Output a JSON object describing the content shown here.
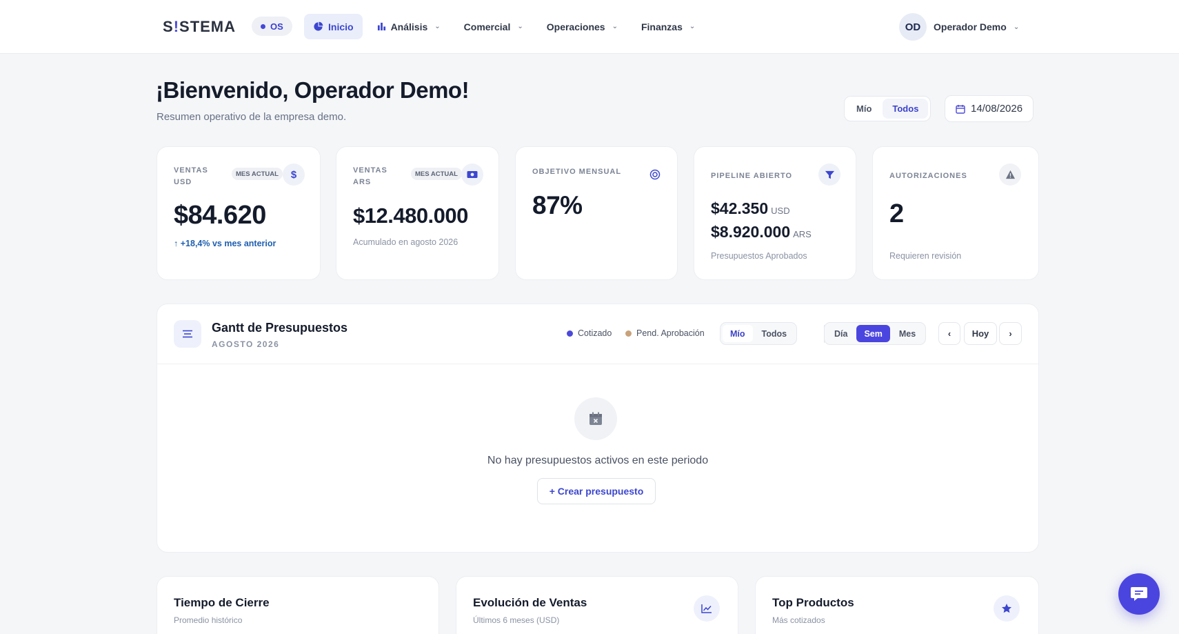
{
  "brand": {
    "logo_prefix": "S",
    "logo_bang": "!",
    "logo_suffix": "STEMA"
  },
  "os_badge": "OS",
  "nav": [
    {
      "label": "Inicio",
      "icon": "pie-chart-icon"
    },
    {
      "label": "Análisis",
      "icon": "bar-chart-icon"
    },
    {
      "label": "Comercial"
    },
    {
      "label": "Operaciones"
    },
    {
      "label": "Finanzas"
    }
  ],
  "user": {
    "initials": "OD",
    "name": "Operador Demo"
  },
  "header": {
    "title": "¡Bienvenido, Operador Demo!",
    "subtitle": "Resumen operativo de la empresa demo.",
    "scope": [
      "Mío",
      "Todos"
    ],
    "scope_selected": "Todos",
    "date": "14/08/2026"
  },
  "kpis": {
    "ventas_usd": {
      "label_1": "VENTAS",
      "label_2": "USD",
      "badge": "MES ACTUAL",
      "icon": "dollar-icon",
      "value": "$84.620",
      "trend": "+18,4% vs mes anterior"
    },
    "ventas_ars": {
      "label_1": "VENTAS",
      "label_2": "ARS",
      "badge": "MES ACTUAL",
      "icon": "cash-icon",
      "value": "$12.480.000",
      "foot": "Acumulado en agosto 2026"
    },
    "objetivo": {
      "label": "OBJETIVO MENSUAL",
      "icon": "target-icon",
      "value": "87%"
    },
    "pipeline": {
      "label": "PIPELINE ABIERTO",
      "icon": "filter-icon",
      "usd_value": "$42.350",
      "usd_unit": "USD",
      "ars_value": "$8.920.000",
      "ars_unit": "ARS",
      "foot": "Presupuestos Aprobados"
    },
    "autorizaciones": {
      "label": "AUTORIZACIONES",
      "icon": "warning-icon",
      "value": "2",
      "foot": "Requieren revisión"
    }
  },
  "gantt": {
    "title": "Gantt de Presupuestos",
    "period": "AGOSTO 2026",
    "legend": [
      {
        "label": "Cotizado",
        "color": "#4b49d9"
      },
      {
        "label": "Pend. Aprobación",
        "color": "#c9a27a"
      }
    ],
    "scope": [
      "Mío",
      "Todos"
    ],
    "scope_selected": "Mío",
    "views": [
      "Día",
      "Sem",
      "Mes"
    ],
    "view_selected": "Sem",
    "today_label": "Hoy",
    "empty_text": "No hay presupuestos activos en este periodo",
    "create_label": "+ Crear presupuesto"
  },
  "bottom_cards": [
    {
      "title": "Tiempo de Cierre",
      "subtitle": "Promedio histórico"
    },
    {
      "title": "Evolución de Ventas",
      "subtitle": "Últimos 6 meses (USD)",
      "icon": "line-chart-icon"
    },
    {
      "title": "Top Productos",
      "subtitle": "Más cotizados",
      "icon": "star-icon"
    }
  ],
  "colors": {
    "accent": "#4b45e0",
    "brand_text": "#2a3140"
  }
}
